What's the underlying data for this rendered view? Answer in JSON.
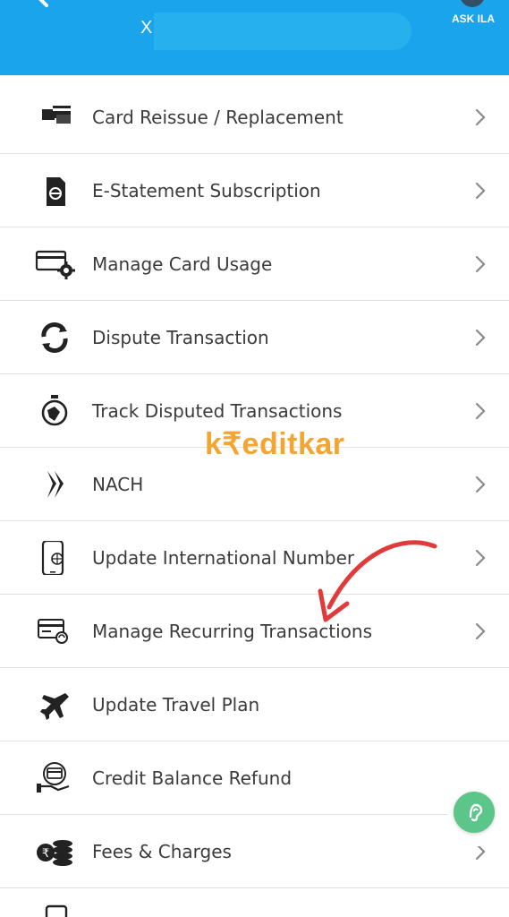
{
  "header": {
    "close_text": "X",
    "ask_label": "ASK ILA",
    "background": "#1aa4ec"
  },
  "menu": {
    "items": [
      {
        "label": "Card Reissue / Replacement",
        "icon": "card-reissue-icon"
      },
      {
        "label": "E-Statement Subscription",
        "icon": "e-statement-icon"
      },
      {
        "label": "Manage Card Usage",
        "icon": "card-settings-icon"
      },
      {
        "label": "Dispute Transaction",
        "icon": "dispute-icon"
      },
      {
        "label": "Track Disputed Transactions",
        "icon": "stopwatch-icon"
      },
      {
        "label": "NACH",
        "icon": "nach-icon"
      },
      {
        "label": "Update International Number",
        "icon": "phone-globe-icon"
      },
      {
        "label": "Manage Recurring Transactions",
        "icon": "recurring-card-icon"
      },
      {
        "label": "Update Travel Plan",
        "icon": "airplane-icon"
      },
      {
        "label": "Credit Balance Refund",
        "icon": "refund-icon"
      },
      {
        "label": "Fees & Charges",
        "icon": "coins-icon"
      }
    ]
  },
  "watermark": "k₹editkar",
  "colors": {
    "accent": "#1aa4ec",
    "watermark": "#f2a531",
    "arrow": "#e03a3a",
    "fab": "#5cc58a"
  }
}
